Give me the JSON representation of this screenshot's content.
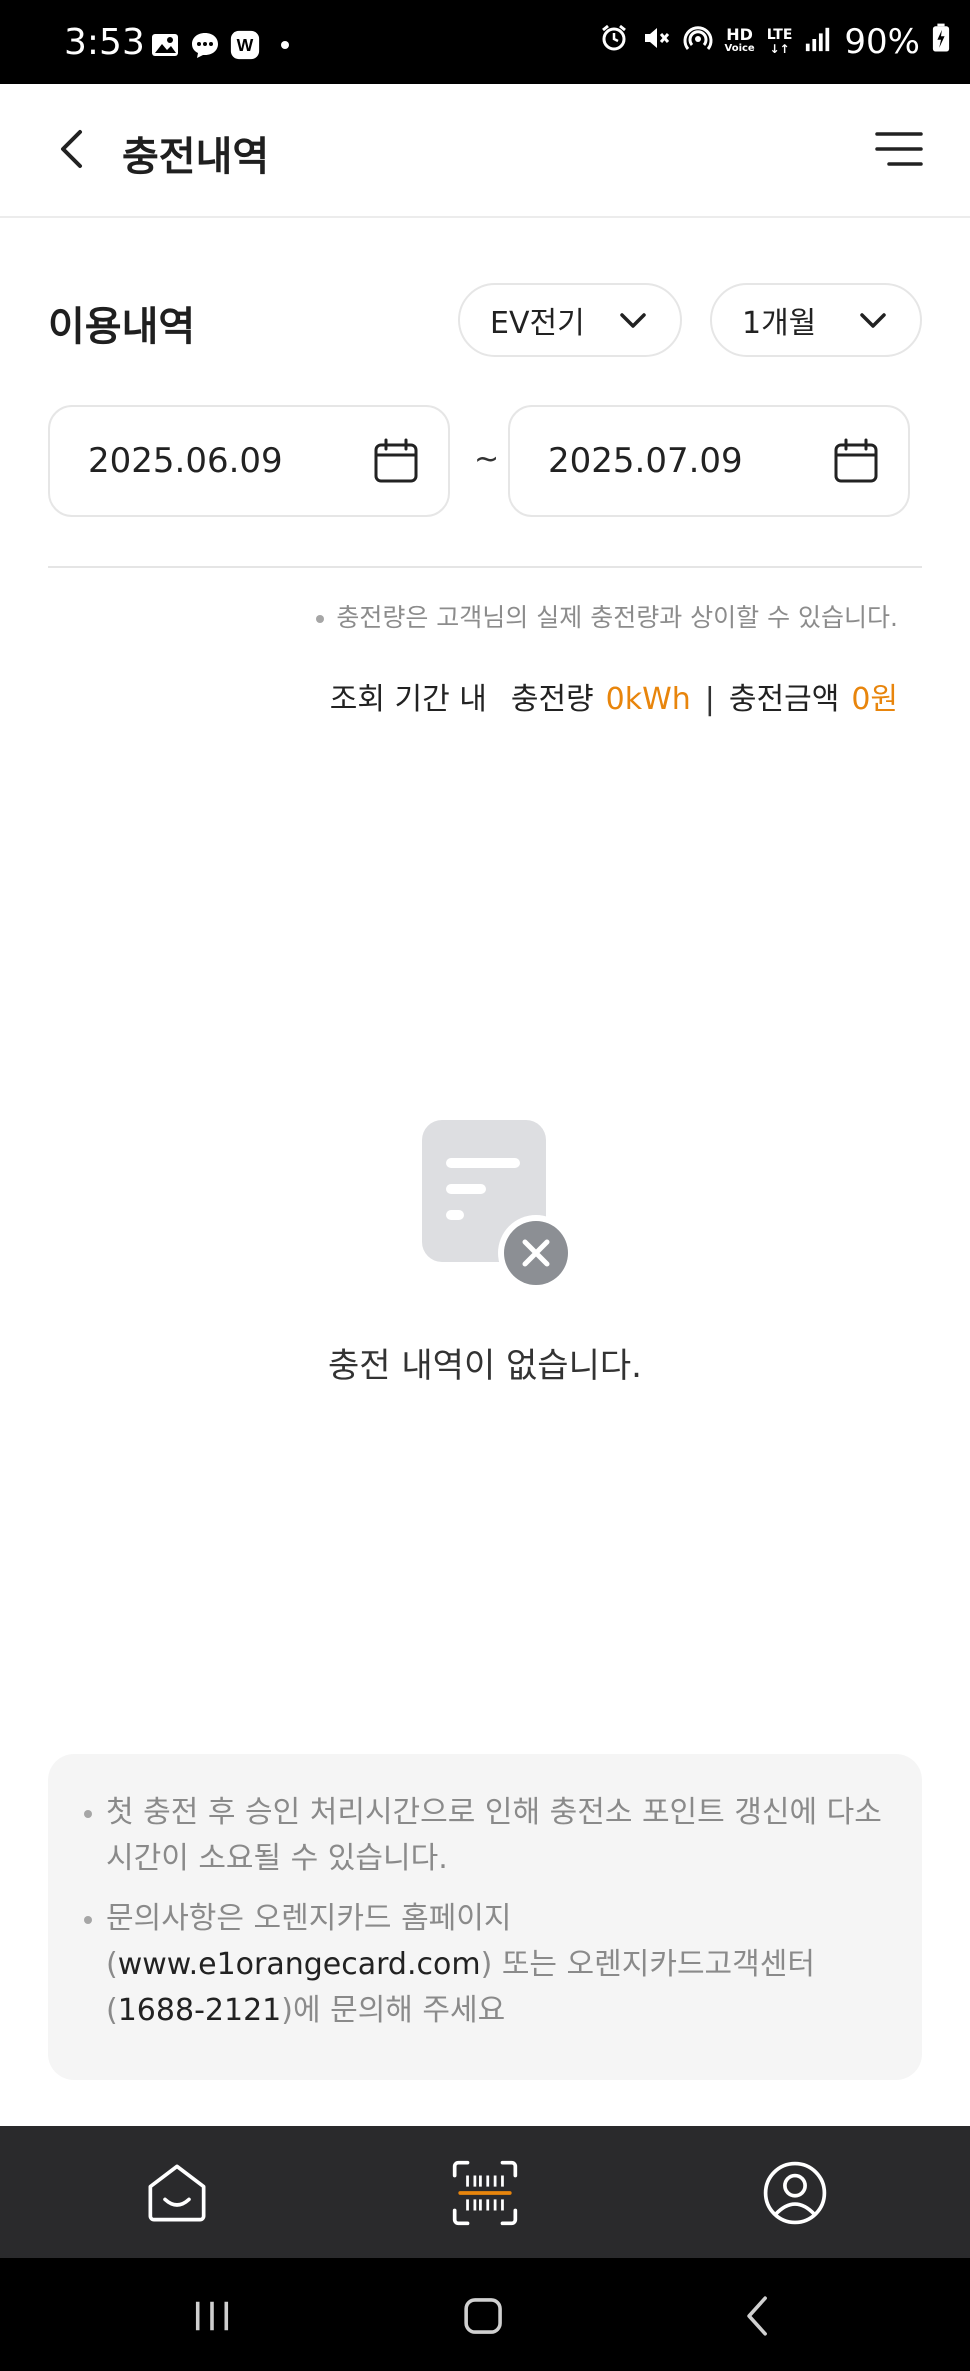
{
  "status_bar": {
    "time": "3:53",
    "battery": "90%",
    "hd_label": "HD",
    "voice_label": "Voice",
    "lte_label": "LTE",
    "left_icons": [
      "gallery-icon",
      "chat-icon",
      "w-app-icon",
      "dot-icon"
    ],
    "right_icons": [
      "alarm-icon",
      "mute-icon",
      "hotspot-icon",
      "hd-voice-icon",
      "lte-icon",
      "signal-icon",
      "battery-icon"
    ]
  },
  "header": {
    "title": "충전내역"
  },
  "filters": {
    "section_title": "이용내역",
    "type_dropdown": "EV전기",
    "period_dropdown": "1개월",
    "start_date": "2025.06.09",
    "end_date": "2025.07.09",
    "separator": "~"
  },
  "notice": "충전량은 고객님의 실제 충전량과 상이할 수 있습니다.",
  "summary": {
    "period_label": "조회 기간 내",
    "amount_label": "충전량",
    "amount_value": "0kWh",
    "divider": "|",
    "price_label": "충전금액",
    "price_value": "0원"
  },
  "empty_state": {
    "message": "충전 내역이 없습니다."
  },
  "info": {
    "item1": "첫 충전 후 승인 처리시간으로 인해 충전소 포인트 갱신에 다소 시간이 소요될 수 있습니다.",
    "item2_prefix": "문의사항은 오렌지카드 홈페이지 (",
    "item2_url": "www.e1orangecard.com",
    "item2_middle": ") 또는 오렌지카드고객센터 (",
    "item2_phone": "1688-2121",
    "item2_suffix": ")에 문의해 주세요"
  },
  "colors": {
    "accent": "#e8850c",
    "nav_bg": "#2a2a2c",
    "info_bg": "#f5f5f5"
  }
}
